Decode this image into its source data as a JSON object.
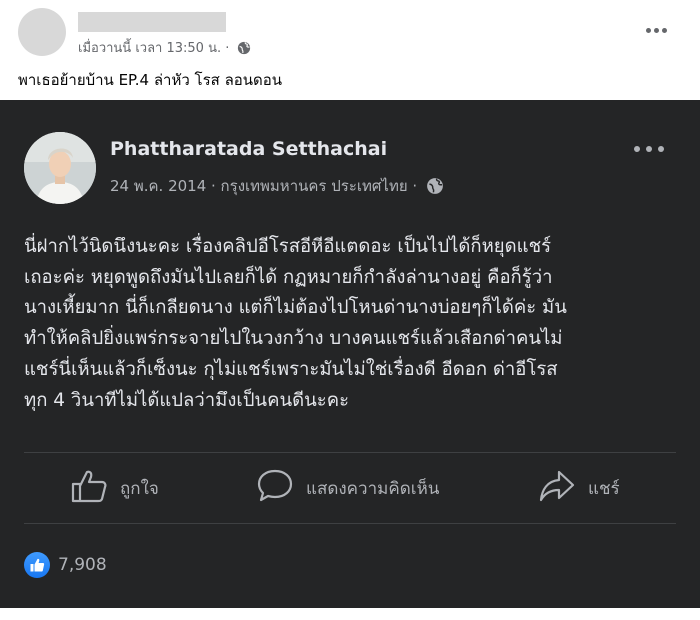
{
  "outer_post": {
    "timestamp": "เมื่อวานนี้ เวลา 13:50 น. ·",
    "text": "พาเธอย้ายบ้าน EP.4 ล่าหัว โรส ลอนดอน"
  },
  "screenshot": {
    "author_name": "Phattharatada Setthachai",
    "meta": "24 พ.ค. 2014 · กรุงเทพมหานคร ประเทศไทย ·",
    "body_lines": [
      "นี่ฝากไว้นิดนึงนะคะ เรื่องคลิปอีโรสอีหีอีแตดอะ เป็นไปได้ก็หยุดแชร์",
      "เถอะค่ะ หยุดพูดถึงมันไปเลยก็ได้ กฏหมายก็กำลังล่านางอยู่ คือก็รู้ว่า",
      "นางเหี้ยมาก นี่ก็เกลียดนาง แต่ก็ไม่ต้องไปโหนด่านางบ่อยๆก็ได้ค่ะ มัน",
      "ทำให้คลิปยิ่งแพร่กระจายไปในวงกว้าง บางคนแชร์แล้วเสือกด่าคนไม่",
      "แชร์นี่เห็นแล้วก็เซ็งนะ กุไม่แชร์เพราะมันไม่ใช่เรื่องดี อีดอก ด่าอีโรส",
      "ทุก 4 วินาทีไม่ได้แปลว่ามึงเป็นคนดีนะคะ"
    ],
    "actions": {
      "like": "ถูกใจ",
      "comment": "แสดงความคิดเห็น",
      "share": "แชร์"
    },
    "reaction_count": "7,908"
  },
  "colors": {
    "card_background": "#242526",
    "primary_text_dark": "#e4e6eb",
    "secondary_text_dark": "#b0b3b8",
    "like_blue": "#1877f2"
  },
  "icons": [
    "globe-icon",
    "more-icon",
    "thumbs-up-icon",
    "comment-icon",
    "share-icon",
    "like-badge-icon"
  ]
}
